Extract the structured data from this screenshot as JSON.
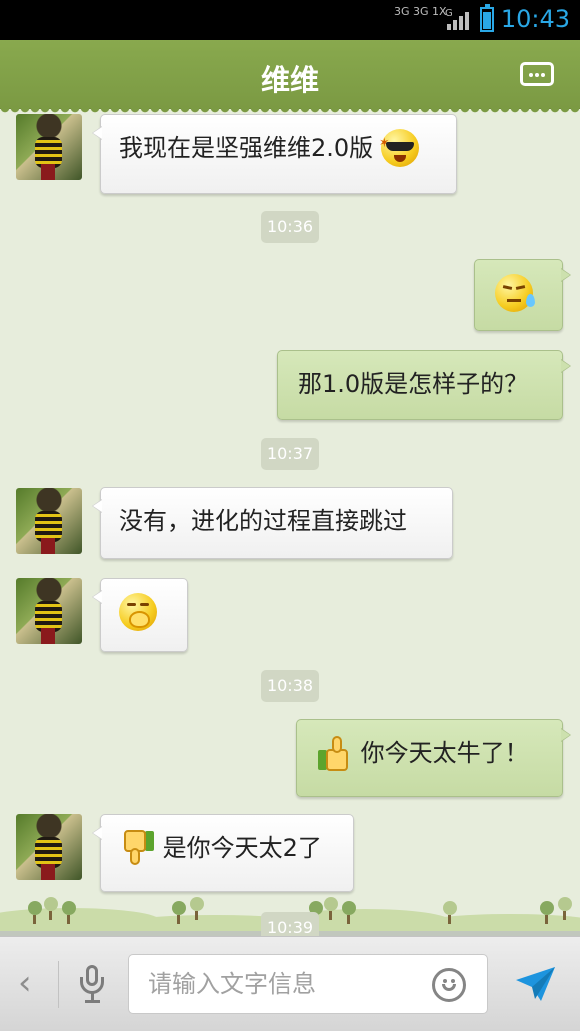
{
  "status_bar": {
    "network": "3G 3G 1X",
    "network_type": "G",
    "time": "10:43",
    "battery_level": 0.8
  },
  "header": {
    "title": "维维"
  },
  "messages": [
    {
      "side": "in",
      "text": "我现在是坚强维维2.0版",
      "emoji": "cool-sunglasses-emoji"
    },
    {
      "type": "timestamp",
      "text": "10:36"
    },
    {
      "side": "out",
      "emoji": "tired-sweat-emoji"
    },
    {
      "side": "out",
      "text": "那1.0版是怎样子的？"
    },
    {
      "type": "timestamp",
      "text": "10:37"
    },
    {
      "side": "in",
      "text": "没有，进化的过程直接跳过"
    },
    {
      "side": "in",
      "emoji": "shy-covering-mouth-emoji"
    },
    {
      "type": "timestamp",
      "text": "10:38"
    },
    {
      "side": "out",
      "text": "你今天太牛了！",
      "emoji": "thumbs-up-emoji"
    },
    {
      "side": "in",
      "text": "是你今天太2了",
      "emoji": "thumbs-down-emoji"
    },
    {
      "type": "timestamp",
      "text": "10:39"
    }
  ],
  "composer": {
    "back_icon": "chevron-left",
    "voice_icon": "microphone",
    "placeholder": "请输入文字信息",
    "emoji_icon": "smiley",
    "send_icon": "paper-plane"
  },
  "colors": {
    "header": "#7b9a43",
    "chat_background": "#e7eddc",
    "incoming_bubble": "#ffffff",
    "outgoing_bubble": "#cde1ae",
    "status_accent": "#2aa8e6"
  }
}
